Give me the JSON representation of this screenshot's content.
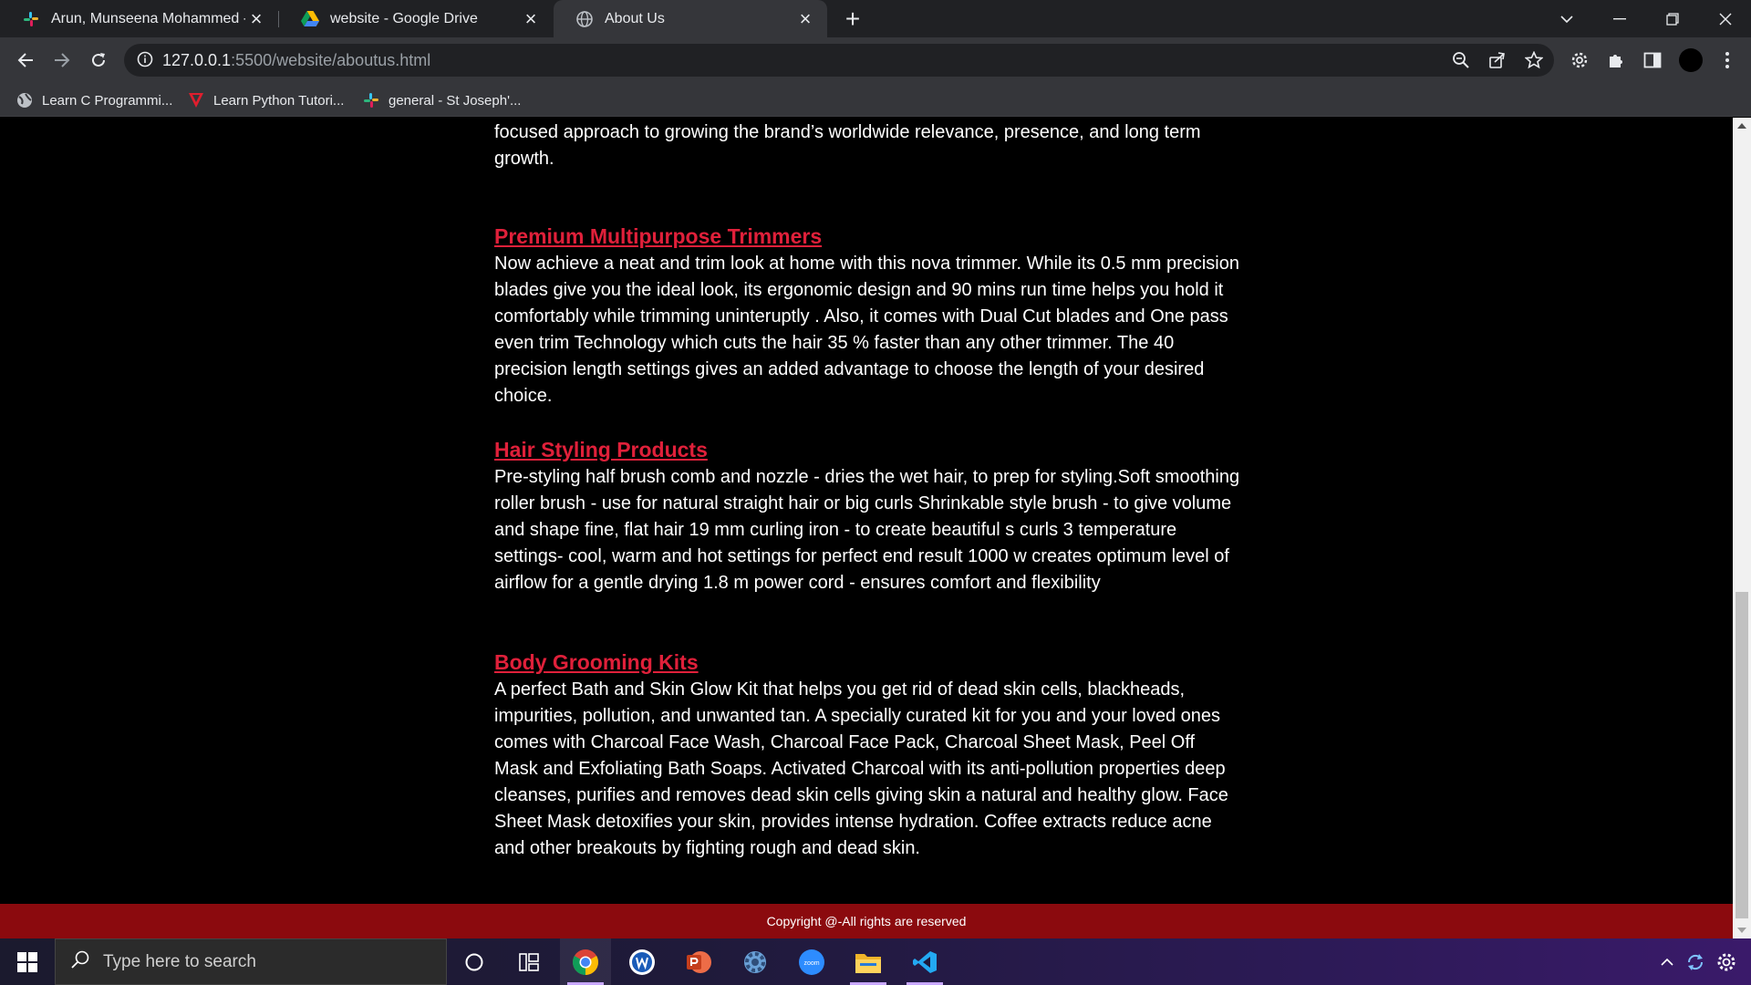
{
  "browser": {
    "tabs": [
      {
        "title": "Arun, Munseena Mohammed - St Joseph's",
        "icon": "slack-icon",
        "active": false
      },
      {
        "title": "website - Google Drive",
        "icon": "google-drive-icon",
        "active": false
      },
      {
        "title": "About Us",
        "icon": "globe-icon",
        "active": true
      }
    ],
    "address": {
      "host": "127.0.0.1",
      "path": ":5500/website/aboutus.html"
    },
    "bookmarks": [
      {
        "label": "Learn C Programmi...",
        "icon": "globe-icon"
      },
      {
        "label": "Learn Python Tutori...",
        "icon": "python-tutorial-icon"
      },
      {
        "label": "general - St Joseph'...",
        "icon": "slack-icon"
      }
    ]
  },
  "page": {
    "intro_text": "focused approach to growing the brand’s worldwide relevance, presence, and long term growth.",
    "sections": [
      {
        "heading": "Premium Multipurpose Trimmers",
        "body": "Now achieve a neat and trim look at home with this nova trimmer. While its 0.5 mm precision blades give you the ideal look, its ergonomic design and 90 mins run time helps you hold it comfortably while trimming uninteruptly . Also, it comes with Dual Cut blades and One pass even trim Technology which cuts the hair 35 % faster than any other trimmer. The 40 precision length settings gives an added advantage to choose the length of your desired choice."
      },
      {
        "heading": "Hair Styling Products",
        "body": "Pre-styling half brush comb and nozzle - dries the wet hair, to prep for styling.Soft smoothing roller brush - use for natural straight hair or big curls Shrinkable style brush - to give volume and shape fine, flat hair 19 mm curling iron - to create beautiful s curls 3 temperature settings- cool, warm and hot settings for perfect end result 1000 w creates optimum level of airflow for a gentle drying 1.8 m power cord - ensures comfort and flexibility"
      },
      {
        "heading": "Body Grooming Kits",
        "body": "A perfect Bath and Skin Glow Kit that helps you get rid of dead skin cells, blackheads, impurities, pollution, and unwanted tan. A specially curated kit for you and your loved ones comes with Charcoal Face Wash, Charcoal Face Pack, Charcoal Sheet Mask, Peel Off Mask and Exfoliating Bath Soaps. Activated Charcoal with its anti-pollution properties deep cleanses, purifies and removes dead skin cells giving skin a natural and healthy glow. Face Sheet Mask detoxifies your skin, provides intense hydration. Coffee extracts reduce acne and other breakouts by fighting rough and dead skin."
      }
    ],
    "footer": "Copyright @-All rights are reserved"
  },
  "taskbar": {
    "search_placeholder": "Type here to search",
    "apps": [
      "cortana-icon",
      "task-view-icon",
      "chrome-icon",
      "word-icon",
      "powerpoint-icon",
      "settings-icon",
      "zoom-icon",
      "file-explorer-icon",
      "vscode-icon"
    ]
  },
  "colors": {
    "heading": "#e0203a",
    "footer_bg": "#8b0a0e",
    "page_bg": "#000000",
    "tab_bar": "#202124",
    "toolbar": "#35363a"
  }
}
